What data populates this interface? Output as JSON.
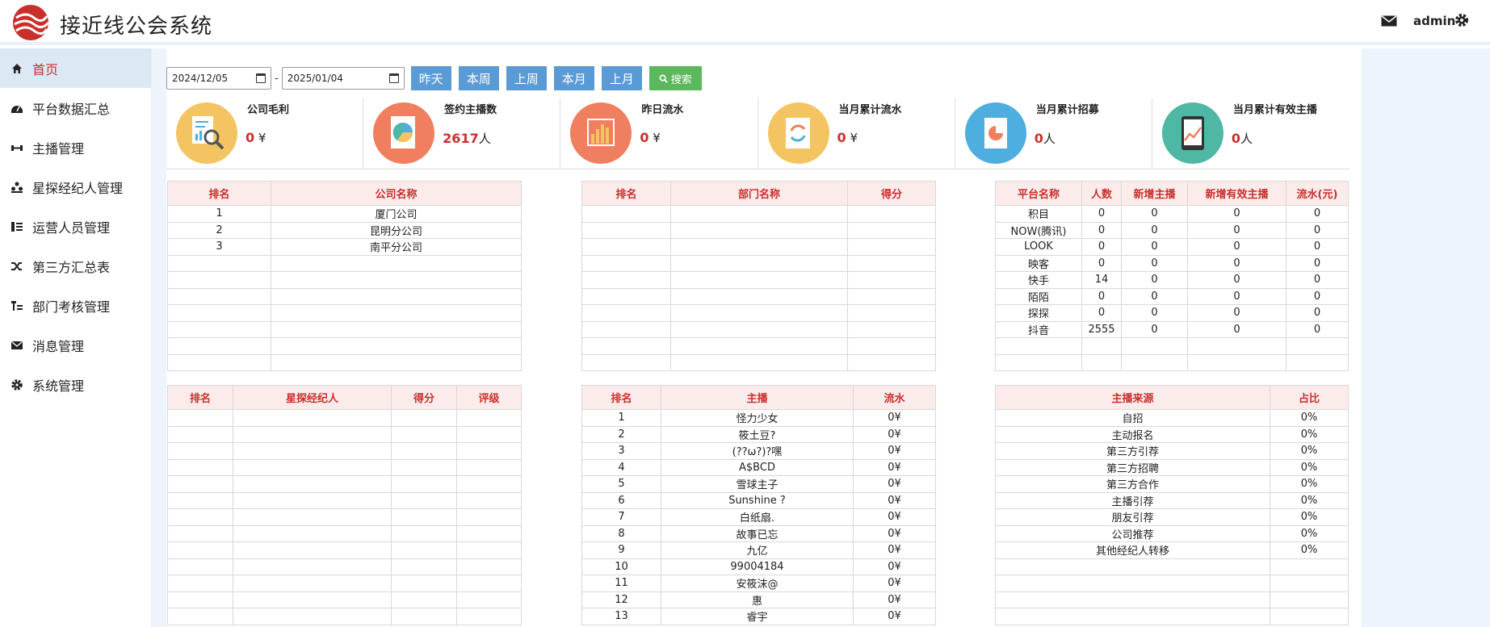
{
  "header": {
    "title": "接近线公会系统",
    "user": "admin"
  },
  "sidebar": {
    "items": [
      {
        "label": "首页",
        "icon": "home-icon"
      },
      {
        "label": "平台数据汇总",
        "icon": "dashboard-icon"
      },
      {
        "label": "主播管理",
        "icon": "fitness-icon"
      },
      {
        "label": "星探经纪人管理",
        "icon": "group-icon"
      },
      {
        "label": "运营人员管理",
        "icon": "list-icon"
      },
      {
        "label": "第三方汇总表",
        "icon": "shuffle-icon"
      },
      {
        "label": "部门考核管理",
        "icon": "tree-icon"
      },
      {
        "label": "消息管理",
        "icon": "envelope-icon"
      },
      {
        "label": "系统管理",
        "icon": "gear-icon"
      }
    ]
  },
  "toolbar": {
    "start_date": "2024/12/05",
    "end_date": "2025/01/04",
    "dash": "-",
    "buttons": [
      "昨天",
      "本周",
      "上周",
      "本月",
      "上月"
    ],
    "search_label": "搜索"
  },
  "stats": [
    {
      "label": "公司毛利",
      "value": "0",
      "unit": "¥",
      "color": "#f5c462"
    },
    {
      "label": "签约主播数",
      "value": "2617",
      "unit": "人",
      "color": "#ef7f5f"
    },
    {
      "label": "昨日流水",
      "value": "0",
      "unit": "¥",
      "color": "#ef7f5f"
    },
    {
      "label": "当月累计流水",
      "value": "0",
      "unit": "¥",
      "color": "#f5c462"
    },
    {
      "label": "当月累计招募",
      "value": "0",
      "unit": "人",
      "color": "#4eaee0"
    },
    {
      "label": "当月累计有效主播",
      "value": "0",
      "unit": "人",
      "color": "#4fb8a4"
    }
  ],
  "company_table": {
    "headers": [
      "排名",
      "公司名称"
    ],
    "rows": [
      [
        "1",
        "厦门公司"
      ],
      [
        "2",
        "昆明分公司"
      ],
      [
        "3",
        "南平分公司"
      ],
      [
        "",
        ""
      ],
      [
        "",
        ""
      ],
      [
        "",
        ""
      ],
      [
        "",
        ""
      ],
      [
        "",
        ""
      ],
      [
        "",
        ""
      ],
      [
        "",
        ""
      ]
    ]
  },
  "dept_table": {
    "headers": [
      "排名",
      "部门名称",
      "得分"
    ],
    "rows": [
      [
        "",
        "",
        ""
      ],
      [
        "",
        "",
        ""
      ],
      [
        "",
        "",
        ""
      ],
      [
        "",
        "",
        ""
      ],
      [
        "",
        "",
        ""
      ],
      [
        "",
        "",
        ""
      ],
      [
        "",
        "",
        ""
      ],
      [
        "",
        "",
        ""
      ],
      [
        "",
        "",
        ""
      ],
      [
        "",
        "",
        ""
      ]
    ]
  },
  "platform_table": {
    "headers": [
      "平台名称",
      "人数",
      "新增主播",
      "新增有效主播",
      "流水(元)"
    ],
    "rows": [
      [
        "积目",
        "0",
        "0",
        "0",
        "0"
      ],
      [
        "NOW(腾讯)",
        "0",
        "0",
        "0",
        "0"
      ],
      [
        "LOOK",
        "0",
        "0",
        "0",
        "0"
      ],
      [
        "映客",
        "0",
        "0",
        "0",
        "0"
      ],
      [
        "快手",
        "14",
        "0",
        "0",
        "0"
      ],
      [
        "陌陌",
        "0",
        "0",
        "0",
        "0"
      ],
      [
        "探探",
        "0",
        "0",
        "0",
        "0"
      ],
      [
        "抖音",
        "2555",
        "0",
        "0",
        "0"
      ],
      [
        "",
        "",
        "",
        "",
        ""
      ],
      [
        "",
        "",
        "",
        "",
        ""
      ]
    ]
  },
  "scout_table": {
    "headers": [
      "排名",
      "星探经纪人",
      "得分",
      "评级"
    ],
    "rows": [
      [
        "",
        "",
        "",
        ""
      ],
      [
        "",
        "",
        "",
        ""
      ],
      [
        "",
        "",
        "",
        ""
      ],
      [
        "",
        "",
        "",
        ""
      ],
      [
        "",
        "",
        "",
        ""
      ],
      [
        "",
        "",
        "",
        ""
      ],
      [
        "",
        "",
        "",
        ""
      ],
      [
        "",
        "",
        "",
        ""
      ],
      [
        "",
        "",
        "",
        ""
      ],
      [
        "",
        "",
        "",
        ""
      ],
      [
        "",
        "",
        "",
        ""
      ],
      [
        "",
        "",
        "",
        ""
      ],
      [
        "",
        "",
        "",
        ""
      ]
    ]
  },
  "anchor_table": {
    "headers": [
      "排名",
      "主播",
      "流水"
    ],
    "rows": [
      [
        "1",
        "怪力少女",
        "0¥"
      ],
      [
        "2",
        "筱土豆?",
        "0¥"
      ],
      [
        "3",
        "(??ω?)?嘿",
        "0¥"
      ],
      [
        "4",
        "A$BCD",
        "0¥"
      ],
      [
        "5",
        "雪球主子",
        "0¥"
      ],
      [
        "6",
        "Sunshine ?",
        "0¥"
      ],
      [
        "7",
        "白纸扇.",
        "0¥"
      ],
      [
        "8",
        "故事已忘",
        "0¥"
      ],
      [
        "9",
        "九亿",
        "0¥"
      ],
      [
        "10",
        "99004184",
        "0¥"
      ],
      [
        "11",
        "安筱沫@",
        "0¥"
      ],
      [
        "12",
        "惠",
        "0¥"
      ],
      [
        "13",
        "睿宇",
        "0¥"
      ]
    ]
  },
  "source_table": {
    "headers": [
      "主播来源",
      "占比"
    ],
    "rows": [
      [
        "自招",
        "0%"
      ],
      [
        "主动报名",
        "0%"
      ],
      [
        "第三方引荐",
        "0%"
      ],
      [
        "第三方招聘",
        "0%"
      ],
      [
        "第三方合作",
        "0%"
      ],
      [
        "主播引荐",
        "0%"
      ],
      [
        "朋友引荐",
        "0%"
      ],
      [
        "公司推荐",
        "0%"
      ],
      [
        "其他经纪人转移",
        "0%"
      ],
      [
        "",
        ""
      ],
      [
        "",
        ""
      ],
      [
        "",
        ""
      ],
      [
        "",
        ""
      ]
    ]
  }
}
